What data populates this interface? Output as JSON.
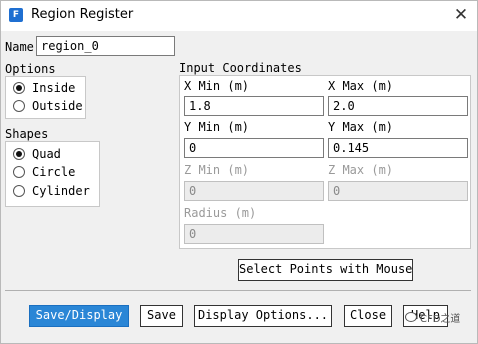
{
  "window": {
    "title": "Region Register",
    "app_icon_letter": "F",
    "close_glyph": "✕"
  },
  "name_field": {
    "label": "Name",
    "value": "region_0"
  },
  "options": {
    "label": "Options",
    "items": [
      {
        "label": "Inside",
        "selected": true
      },
      {
        "label": "Outside",
        "selected": false
      }
    ]
  },
  "shapes": {
    "label": "Shapes",
    "items": [
      {
        "label": "Quad",
        "selected": true
      },
      {
        "label": "Circle",
        "selected": false
      },
      {
        "label": "Cylinder",
        "selected": false
      }
    ]
  },
  "coords": {
    "label": "Input Coordinates",
    "x_min": {
      "label": "X Min (m)",
      "value": "1.8"
    },
    "x_max": {
      "label": "X Max (m)",
      "value": "2.0"
    },
    "y_min": {
      "label": "Y Min (m)",
      "value": "0"
    },
    "y_max": {
      "label": "Y Max (m)",
      "value": "0.145"
    },
    "z_min": {
      "label": "Z Min (m)",
      "value": "0"
    },
    "z_max": {
      "label": "Z Max (m)",
      "value": "0"
    },
    "radius": {
      "label": "Radius (m)",
      "value": "0"
    },
    "select_points_label": "Select Points with Mouse"
  },
  "footer": {
    "save_display": "Save/Display",
    "save": "Save",
    "display_options": "Display Options...",
    "close": "Close",
    "help": "Help"
  },
  "watermark": {
    "text": "CFD之道"
  },
  "colors": {
    "primary": "#2a86d6",
    "icon": "#1f6fd1"
  }
}
